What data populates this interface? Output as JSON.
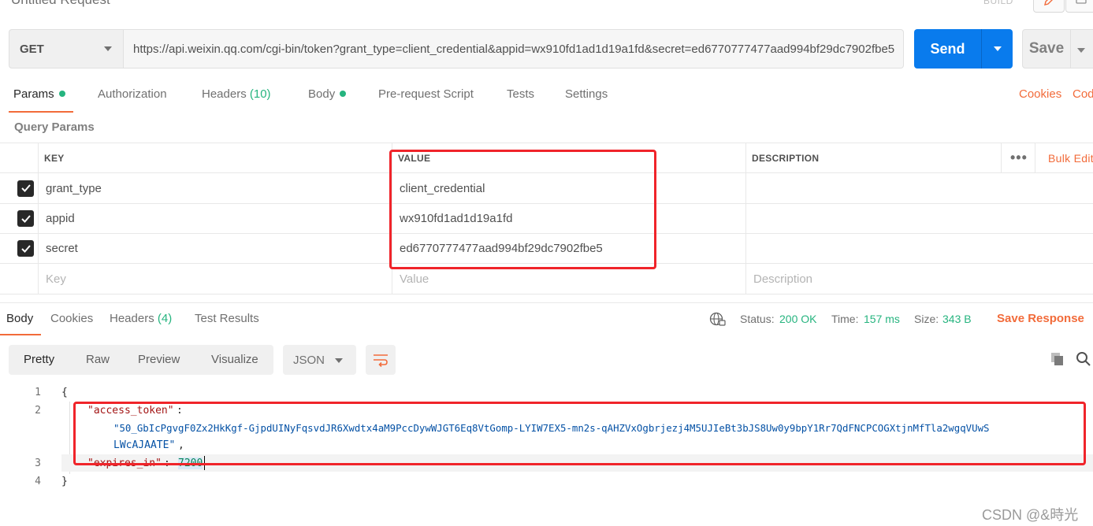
{
  "request": {
    "title": "Untitled Request",
    "build_label": "BUILD",
    "method": "GET",
    "url": "https://api.weixin.qq.com/cgi-bin/token?grant_type=client_credential&appid=wx910fd1ad1d19a1fd&secret=ed6770777477aad994bf29dc7902fbe5",
    "send_label": "Send",
    "save_label": "Save"
  },
  "tabs": [
    {
      "label": "Params",
      "dot": true
    },
    {
      "label": "Authorization"
    },
    {
      "label": "Headers",
      "count": "(10)"
    },
    {
      "label": "Body",
      "dot": true
    },
    {
      "label": "Pre-request Script"
    },
    {
      "label": "Tests"
    },
    {
      "label": "Settings"
    }
  ],
  "right_links": {
    "cookies": "Cookies",
    "code": "Code"
  },
  "query_params": {
    "title": "Query Params",
    "headers": {
      "key": "KEY",
      "value": "VALUE",
      "description": "DESCRIPTION",
      "bulk_edit": "Bulk Edit"
    },
    "rows": [
      {
        "key": "grant_type",
        "value": "client_credential",
        "checked": true
      },
      {
        "key": "appid",
        "value": "wx910fd1ad1d19a1fd",
        "checked": true
      },
      {
        "key": "secret",
        "value": "ed6770777477aad994bf29dc7902fbe5",
        "checked": true
      }
    ],
    "placeholder": {
      "key": "Key",
      "value": "Value",
      "description": "Description"
    }
  },
  "response": {
    "tabs": [
      {
        "label": "Body"
      },
      {
        "label": "Cookies"
      },
      {
        "label": "Headers",
        "count": "(4)"
      },
      {
        "label": "Test Results"
      }
    ],
    "status_label": "Status:",
    "status_value": "200 OK",
    "time_label": "Time:",
    "time_value": "157 ms",
    "size_label": "Size:",
    "size_value": "343 B",
    "save_response": "Save Response",
    "view_modes": [
      "Pretty",
      "Raw",
      "Preview",
      "Visualize"
    ],
    "format": "JSON",
    "body": {
      "line1": "{",
      "key1": "\"access_token\"",
      "val1a": "\"50_GbIcPgvgF0Zx2HkKgf-GjpdUINyFqsvdJR6Xwdtx4aM9PccDywWJGT6Eq8VtGomp-LYIW7EX5-mn2s-qAHZVxOgbrjezj4M5UJIeBt3bJS8Uw0y9bpY1Rr7QdFNCPCOGXtjnMfTla2wgqVUwS",
      "val1b": "LWcAJAATE\"",
      "key2": "\"expires_in\"",
      "val2": "7200",
      "line4": "}",
      "line_numbers": [
        "1",
        "2",
        "3",
        "4"
      ]
    }
  },
  "watermark": "CSDN @&時光"
}
